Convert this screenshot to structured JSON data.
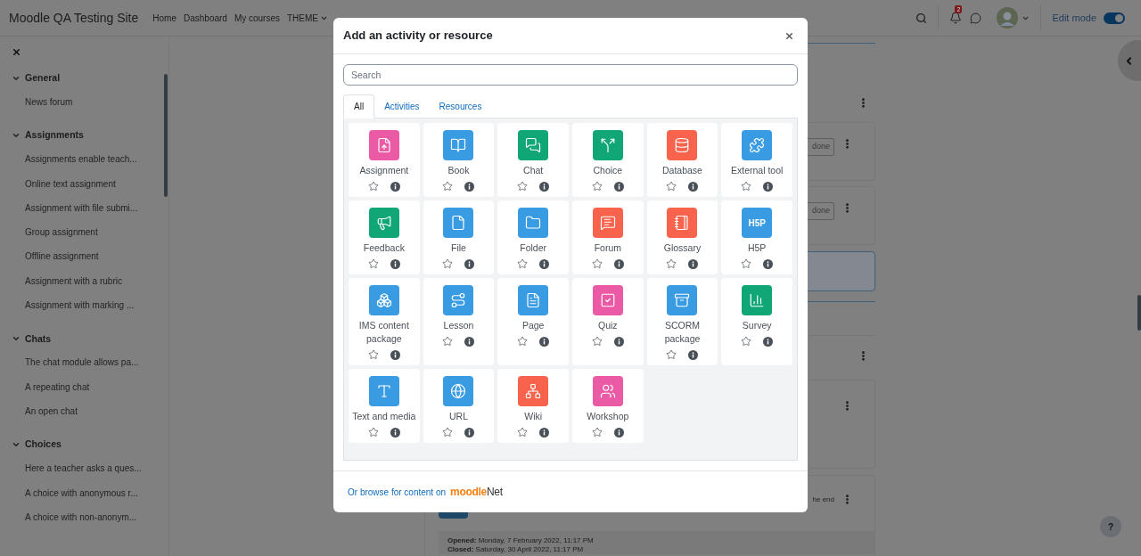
{
  "navbar": {
    "site_name": "Moodle QA Testing Site",
    "links": [
      {
        "label": "Home",
        "dropdown": false
      },
      {
        "label": "Dashboard",
        "dropdown": false
      },
      {
        "label": "My courses",
        "dropdown": false
      },
      {
        "label": "THEME",
        "dropdown": true
      }
    ],
    "notification_count": "2",
    "edit_mode": {
      "label": "Edit mode",
      "on": true
    }
  },
  "course_index": {
    "sections": [
      {
        "title": "General",
        "expanded": true,
        "items": [
          "News forum"
        ]
      },
      {
        "title": "Assignments",
        "expanded": true,
        "items": [
          "Assignments enable teach...",
          "Online text assignment",
          "Assignment with file submi...",
          "Group assignment",
          "Offline assignment",
          "Assignment with a rubric",
          "Assignment with marking ..."
        ]
      },
      {
        "title": "Chats",
        "expanded": true,
        "items": [
          "The chat module allows pa...",
          "A repeating chat",
          "An open chat"
        ]
      },
      {
        "title": "Choices",
        "expanded": true,
        "items": [
          "Here a teacher asks a ques...",
          "A choice with anonymous r...",
          "A choice with non-anonym..."
        ]
      }
    ]
  },
  "course_content": {
    "completion_buttons": [
      "done",
      "done"
    ],
    "restriction_text": "he end",
    "dates": [
      "**Opened:** Monday, 7 February 2022, 11:17 PM",
      "**Closed:** Saturday, 30 April 2022, 11:17 PM"
    ]
  },
  "help_button": "?",
  "dialog": {
    "title": "Add an activity or resource",
    "search": {
      "placeholder": "Search"
    },
    "tabs": [
      {
        "label": "All",
        "selected": true
      },
      {
        "label": "Activities",
        "selected": false
      },
      {
        "label": "Resources",
        "selected": false
      }
    ],
    "items": [
      {
        "name": "Assignment",
        "color": "#eb5aa5",
        "starred": false
      },
      {
        "name": "Book",
        "color": "#399be2",
        "starred": false
      },
      {
        "name": "Chat",
        "color": "#11a676",
        "starred": false
      },
      {
        "name": "Choice",
        "color": "#11a676",
        "starred": false
      },
      {
        "name": "Database",
        "color": "#f7634d",
        "starred": false
      },
      {
        "name": "External tool",
        "color": "#399be2",
        "starred": false
      },
      {
        "name": "Feedback",
        "color": "#11a676",
        "starred": false
      },
      {
        "name": "File",
        "color": "#399be2",
        "starred": false
      },
      {
        "name": "Folder",
        "color": "#399be2",
        "starred": false
      },
      {
        "name": "Forum",
        "color": "#f7634d",
        "starred": false
      },
      {
        "name": "Glossary",
        "color": "#f7634d",
        "starred": false
      },
      {
        "name": "H5P",
        "color": "#399be2",
        "starred": false,
        "icon_label": "H5P"
      },
      {
        "name": "IMS content package",
        "color": "#399be2",
        "starred": false
      },
      {
        "name": "Lesson",
        "color": "#399be2",
        "starred": false
      },
      {
        "name": "Page",
        "color": "#399be2",
        "starred": false
      },
      {
        "name": "Quiz",
        "color": "#eb5aa5",
        "starred": false
      },
      {
        "name": "SCORM package",
        "color": "#399be2",
        "starred": false
      },
      {
        "name": "Survey",
        "color": "#11a676",
        "starred": false
      },
      {
        "name": "Text and media",
        "color": "#399be2",
        "starred": false
      },
      {
        "name": "URL",
        "color": "#399be2",
        "starred": false
      },
      {
        "name": "Wiki",
        "color": "#f7634d",
        "starred": false
      },
      {
        "name": "Workshop",
        "color": "#eb5aa5",
        "starred": false
      }
    ],
    "footer": {
      "text": "Or browse for content on",
      "logo_main": "moodle",
      "logo_suffix": "Net"
    }
  }
}
